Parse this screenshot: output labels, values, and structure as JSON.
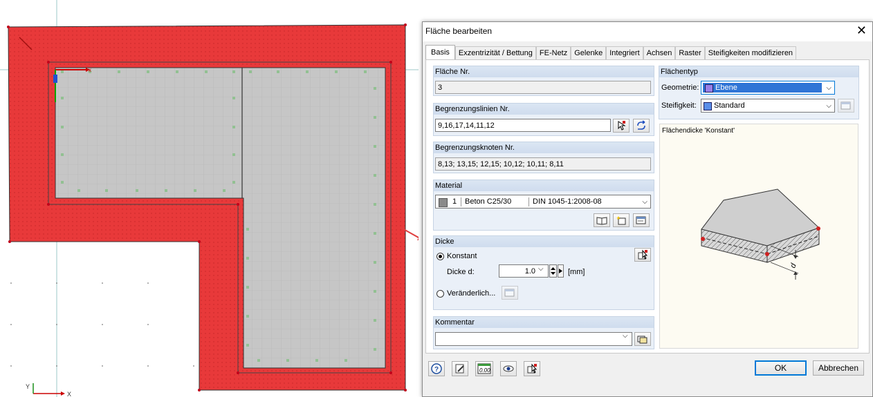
{
  "colors": {
    "surface_outer": "#e8393a",
    "surface_inner": "#c8c8c8",
    "selection": "#3075d6",
    "accent": "#0078d7"
  },
  "canvas": {
    "axis_x_label": "X",
    "axis_y_label": "Y"
  },
  "dialog": {
    "title": "Fläche bearbeiten",
    "close_icon": "close-icon",
    "tabs": [
      "Basis",
      "Exzentrizität / Bettung",
      "FE-Netz",
      "Gelenke",
      "Integriert",
      "Achsen",
      "Raster",
      "Steifigkeiten modifizieren"
    ],
    "flaeche_nr": {
      "heading": "Fläche Nr.",
      "value": "3"
    },
    "begrenzungslinien": {
      "heading": "Begrenzungslinien Nr.",
      "value": "9,16,17,14,11,12"
    },
    "begrenzungsknoten": {
      "heading": "Begrenzungsknoten Nr.",
      "value": "8,13; 13,15; 12,15; 10,12; 10,11; 8,11"
    },
    "material": {
      "heading": "Material",
      "number": "1",
      "name": "Beton C25/30",
      "norm": "DIN 1045-1:2008-08"
    },
    "dicke": {
      "heading": "Dicke",
      "option_constant": "Konstant",
      "dicke_label": "Dicke d:",
      "value": "1.0",
      "unit": "[mm]",
      "option_variable": "Veränderlich..."
    },
    "kommentar": {
      "heading": "Kommentar",
      "value": ""
    },
    "flaechentyp": {
      "heading": "Flächentyp",
      "geometrie_label": "Geometrie:",
      "geometrie_value": "Ebene",
      "steifigkeit_label": "Steifigkeit:",
      "steifigkeit_value": "Standard"
    },
    "preview": {
      "caption": "Flächendicke 'Konstant'",
      "dim_label": "d"
    },
    "buttons": {
      "ok": "OK",
      "cancel": "Abbrechen"
    }
  }
}
